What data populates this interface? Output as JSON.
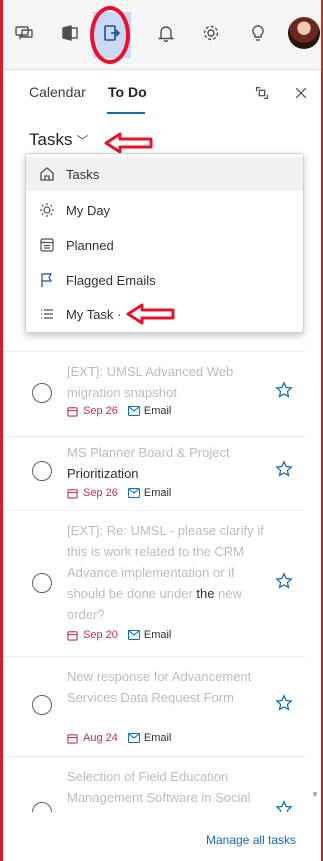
{
  "toolbar": {
    "icons": [
      "chat-icon",
      "office-icon",
      "todo-icon",
      "bell-icon",
      "gear-icon",
      "lightbulb-icon"
    ],
    "active": "todo-icon"
  },
  "tabs": {
    "calendar": "Calendar",
    "todo": "To Do"
  },
  "tasks_header": {
    "title": "Tasks"
  },
  "dropdown": {
    "items": [
      {
        "label": "Tasks",
        "icon": "home-icon"
      },
      {
        "label": "My Day",
        "icon": "sun-icon"
      },
      {
        "label": "Planned",
        "icon": "calendar-grid-icon"
      },
      {
        "label": "Flagged Emails",
        "icon": "flag-icon"
      },
      {
        "label": "My Task ·",
        "icon": "list-icon"
      }
    ],
    "selected_index": 0
  },
  "tasks": [
    {
      "title_light": "[EXT]: UMSL Advanced Web migration snapshot",
      "title_dark": "",
      "date": "Sep 26",
      "source": "Email"
    },
    {
      "title_light": "MS Planner Board & Project",
      "title_dark": "Prioritization",
      "date": "Sep 26",
      "source": "Email"
    },
    {
      "title_light": "[EXT]: Re: UMSL - please clarify if this is work related to the CRM Advance implementation or if should be done under",
      "title_dark": "the",
      "title_tail": "new order?",
      "date": "Sep 20",
      "source": "Email"
    },
    {
      "title_light": "New response for Advancement Services Data Request Form",
      "title_dark": "",
      "date": "Aug 24",
      "source": "Email"
    },
    {
      "title_light": "Selection of Field Education Management Software in Social",
      "title_dark": "",
      "date": "",
      "source": ""
    }
  ],
  "footer": {
    "manage_link": "Manage all tasks"
  },
  "colors": {
    "accent": "#0f6cbd",
    "annotation_red": "#e8102d",
    "due_date": "#c4314b"
  }
}
